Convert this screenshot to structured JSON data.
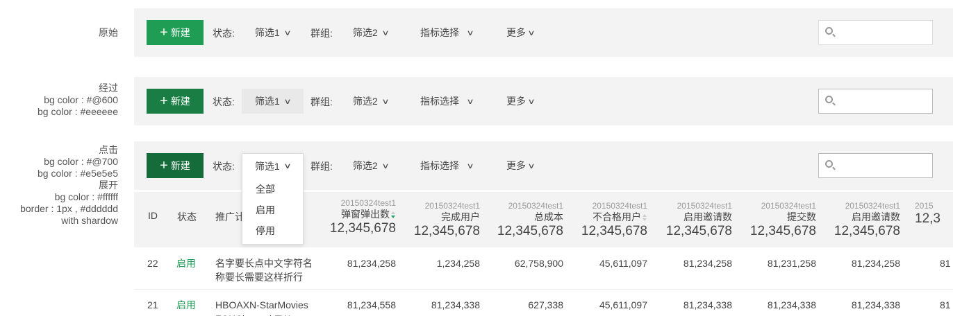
{
  "notes": {
    "n1": [
      "原始"
    ],
    "n2": [
      "经过",
      "bg color : #@600",
      "bg color : #eeeeee"
    ],
    "n3": [
      "点击",
      "bg color : #@700",
      "bg color : #e5e5e5",
      "展开",
      "bg color : #ffffff",
      "border : 1px , #dddddd",
      "with shardow"
    ]
  },
  "toolbar": {
    "new_label": "新建",
    "plus": "+",
    "status_label": "状态:",
    "filter1": "筛选1",
    "group_label": "群组:",
    "filter2": "筛选2",
    "metric_select": "指标选择",
    "more": "更多",
    "chevron": "∨",
    "search_placeholder": ""
  },
  "colors": {
    "btn_normal": "#1f9d55",
    "btn_hover": "#1a7e44",
    "btn_active": "#166b3a",
    "hover_bg": "#eeeeee",
    "status_green": "#1f9d55"
  },
  "dropdown": {
    "options": [
      "全部",
      "启用",
      "停用"
    ]
  },
  "table": {
    "headers": {
      "id": "ID",
      "status": "状态",
      "promo": "推广计划"
    },
    "metrics": [
      {
        "date": "20150324test1",
        "name": "弹窗弹出数",
        "total": "12,345,678",
        "sort": "desc"
      },
      {
        "date": "20150324test1",
        "name": "完成用户",
        "total": "12,345,678",
        "sort": ""
      },
      {
        "date": "20150324test1",
        "name": "总成本",
        "total": "12,345,678",
        "sort": ""
      },
      {
        "date": "20150324test1",
        "name": "不合格用户",
        "total": "12,345,678",
        "sort": "both"
      },
      {
        "date": "20150324test1",
        "name": "启用邀请数",
        "total": "12,345,678",
        "sort": ""
      },
      {
        "date": "20150324test1",
        "name": "提交数",
        "total": "12,345,678",
        "sort": ""
      },
      {
        "date": "20150324test1",
        "name": "启用邀请数",
        "total": "12,345,678",
        "sort": ""
      },
      {
        "date": "2015",
        "name": "",
        "total": "12,3",
        "sort": ""
      }
    ],
    "rows": [
      {
        "id": "22",
        "status": "启用",
        "name": "名字要长点中文字符名称要长需要这样折行",
        "values": [
          "81,234,258",
          "1,234,258",
          "62,758,900",
          "45,611,097",
          "81,234,258",
          "81,231,258",
          "81,234,258",
          "81"
        ]
      },
      {
        "id": "21",
        "status": "启用",
        "name": "HBOAXN-StarMovies FOXChannel-TW",
        "values": [
          "81,234,558",
          "81,234,338",
          "627,338",
          "45,611,097",
          "81,234,338",
          "81,234,338",
          "81,234,338",
          "81"
        ]
      }
    ]
  }
}
